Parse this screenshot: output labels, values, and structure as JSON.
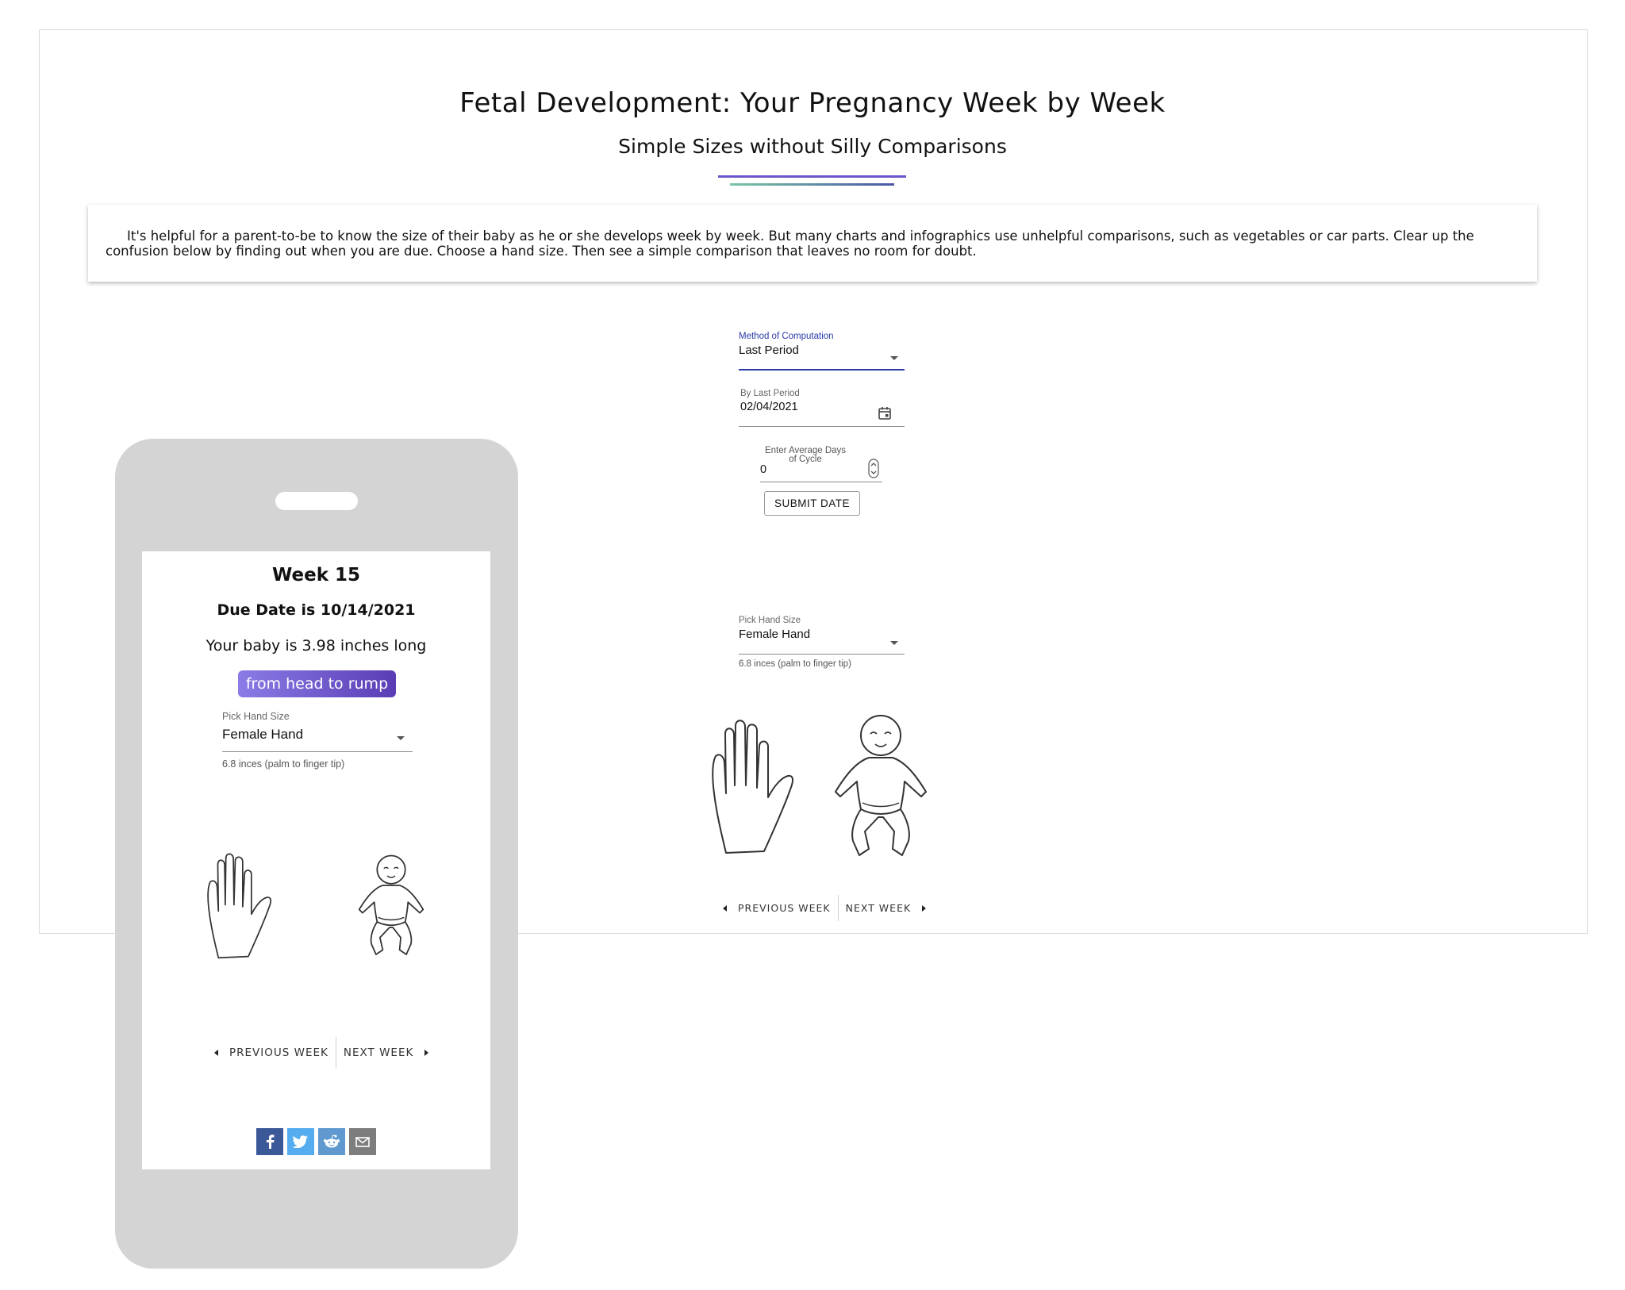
{
  "header": {
    "title": "Fetal Development: Your Pregnancy Week by Week",
    "subtitle": "Simple Sizes without Silly Comparisons"
  },
  "intro": {
    "text": "It's helpful for a parent-to-be to know the size of their baby as he or she develops week by week. But many charts and infographics use unhelpful comparisons, such as vegetables or car parts. Clear up the confusion below by finding out when you are due. Choose a hand size. Then see a simple comparison that leaves no room for doubt."
  },
  "form": {
    "method_label": "Method of Computation",
    "method_value": "Last Period",
    "last_period_label": "By Last Period",
    "last_period_value": "02/04/2021",
    "cycle_label": "Enter Average Days of Cycle",
    "cycle_value": "0",
    "submit_label": "SUBMIT DATE"
  },
  "hand": {
    "label": "Pick Hand Size",
    "value": "Female Hand",
    "helper": "6.8 inces (palm to finger tip)"
  },
  "nav": {
    "prev_label": "PREVIOUS WEEK",
    "next_label": "NEXT WEEK"
  },
  "phone": {
    "week": "Week 15",
    "due_date": "Due Date is 10/14/2021",
    "baby_size": "Your baby is 3.98 inches long",
    "measure": "from head to rump",
    "hand_label": "Pick Hand Size",
    "hand_value": "Female Hand",
    "hand_helper": "6.8 inces (palm to finger tip)",
    "prev_label": "PREVIOUS WEEK",
    "next_label": "NEXT WEEK",
    "share": [
      {
        "icon": "facebook-icon",
        "color": "#3b5998"
      },
      {
        "icon": "twitter-icon",
        "color": "#55acee"
      },
      {
        "icon": "reddit-icon",
        "color": "#5f99cf"
      },
      {
        "icon": "email-icon",
        "color": "#7d7d7d"
      }
    ]
  }
}
